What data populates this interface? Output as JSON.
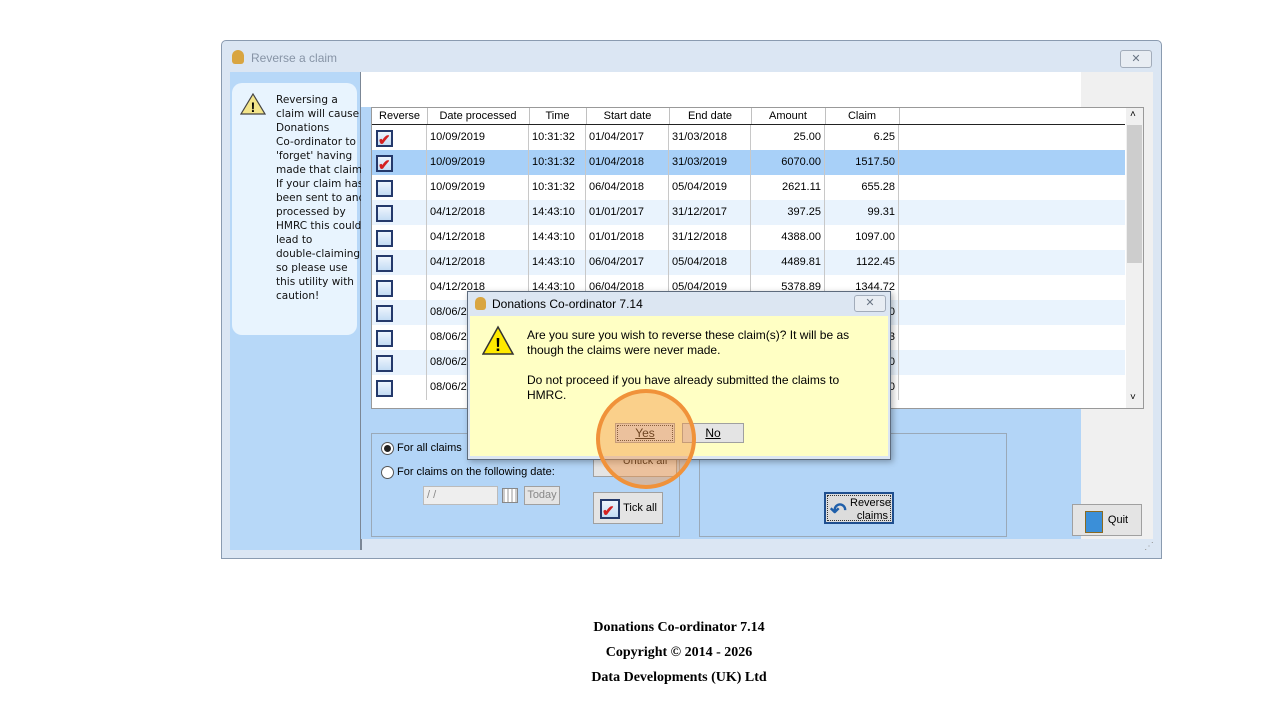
{
  "window": {
    "title": "Reverse a claim",
    "close": "✕"
  },
  "warning": {
    "text": "Reversing a\nclaim will cause\nDonations\nCo-ordinator to\n'forget' having\nmade that claim\nIf your claim has\nbeen sent to and\nprocessed by\nHMRC this could\nlead to\ndouble-claiming,\nso please use\nthis utility with\ncaution!"
  },
  "table": {
    "columns": [
      "Reverse",
      "Date processed",
      "Time",
      "Start date",
      "End date",
      "Amount",
      "Claim"
    ],
    "rows": [
      {
        "checked": true,
        "date": "10/09/2019",
        "time": "10:31:32",
        "start": "01/04/2017",
        "end": "31/03/2018",
        "amount": "25.00",
        "claim": "6.25"
      },
      {
        "checked": true,
        "date": "10/09/2019",
        "time": "10:31:32",
        "start": "01/04/2018",
        "end": "31/03/2019",
        "amount": "6070.00",
        "claim": "1517.50"
      },
      {
        "checked": false,
        "date": "10/09/2019",
        "time": "10:31:32",
        "start": "06/04/2018",
        "end": "05/04/2019",
        "amount": "2621.11",
        "claim": "655.28"
      },
      {
        "checked": false,
        "date": "04/12/2018",
        "time": "14:43:10",
        "start": "01/01/2017",
        "end": "31/12/2017",
        "amount": "397.25",
        "claim": "99.31"
      },
      {
        "checked": false,
        "date": "04/12/2018",
        "time": "14:43:10",
        "start": "01/01/2018",
        "end": "31/12/2018",
        "amount": "4388.00",
        "claim": "1097.00"
      },
      {
        "checked": false,
        "date": "04/12/2018",
        "time": "14:43:10",
        "start": "06/04/2017",
        "end": "05/04/2018",
        "amount": "4489.81",
        "claim": "1122.45"
      },
      {
        "checked": false,
        "date": "04/12/2018",
        "time": "14:43:10",
        "start": "06/04/2018",
        "end": "05/04/2019",
        "amount": "5378.89",
        "claim": "1344.72"
      },
      {
        "checked": false,
        "date": "08/06/20",
        "time": "",
        "start": "",
        "end": "",
        "amount": "",
        "claim": "0"
      },
      {
        "checked": false,
        "date": "08/06/20",
        "time": "",
        "start": "",
        "end": "",
        "amount": "",
        "claim": "3"
      },
      {
        "checked": false,
        "date": "08/06/20",
        "time": "",
        "start": "",
        "end": "",
        "amount": "",
        "claim": "0"
      },
      {
        "checked": false,
        "date": "08/06/20",
        "time": "",
        "start": "",
        "end": "",
        "amount": "",
        "claim": "0"
      }
    ],
    "selected_row": 1
  },
  "options": {
    "all_claims": "For all claims",
    "on_date": "For claims on the following date:",
    "date_value": " / /",
    "today": "Today",
    "untick_all": "Untick all",
    "tick_all": "Tick all",
    "selected": "all_claims"
  },
  "actions": {
    "reverse_claims": "Reverse\nclaims",
    "quit": "Quit"
  },
  "dialog": {
    "title": "Donations Co-ordinator 7.14",
    "close": "✕",
    "message1": "Are you sure you wish to reverse these claim(s)? It will be as though the claims were never made.",
    "message2": "Do not proceed if you have already submitted the claims to HMRC.",
    "yes": "Yes",
    "no": "No"
  },
  "footer": {
    "line1": "Donations Co-ordinator 7.14",
    "line2": "Copyright © 2014 - 2026",
    "line3": "Data Developments (UK) Ltd"
  },
  "colors": {
    "selected_row": "#a8d0f8",
    "alt_row": "#e9f3fd",
    "highlight": "#f0923a"
  }
}
